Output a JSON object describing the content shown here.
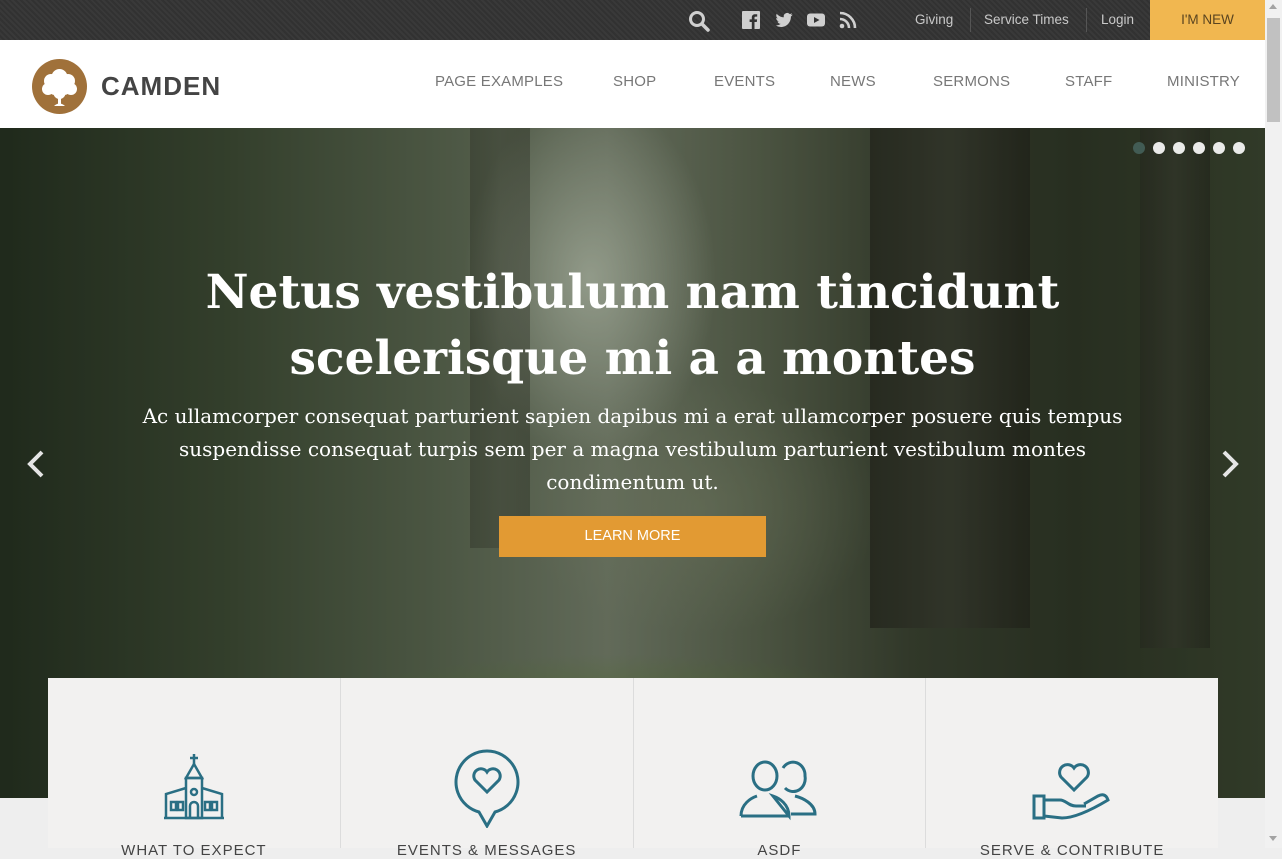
{
  "topbar": {
    "icons": [
      "search-icon",
      "facebook-icon",
      "twitter-icon",
      "youtube-icon",
      "rss-icon"
    ],
    "links": [
      "Giving",
      "Service Times",
      "Login"
    ],
    "cta": "I'M NEW",
    "cta_color": "#f1b750"
  },
  "header": {
    "logo_text": "CAMDEN",
    "logo_icon": "tree-icon",
    "brand_color": "#a0713a",
    "nav": [
      "PAGE EXAMPLES",
      "SHOP",
      "EVENTS",
      "NEWS",
      "SERMONS",
      "STAFF",
      "MINISTRY"
    ]
  },
  "hero": {
    "title": "Netus vestibulum nam tincidunt scelerisque mi a a montes",
    "description": "Ac ullamcorper consequat parturient sapien dapibus mi a erat ullamcorper posuere quis tempus suspendisse consequat turpis sem per a magna vestibulum parturient vestibulum montes condimentum ut.",
    "button": "LEARN MORE",
    "button_color": "#e29a33",
    "slide_count": 6,
    "active_slide": 1
  },
  "features": [
    {
      "label": "WHAT TO EXPECT",
      "icon": "church-icon"
    },
    {
      "label": "EVENTS & MESSAGES",
      "icon": "heart-bubble-icon"
    },
    {
      "label": "ASDF",
      "icon": "people-icon"
    },
    {
      "label": "SERVE & CONTRIBUTE",
      "icon": "hand-heart-icon"
    }
  ],
  "accent_teal": "#2a6f84"
}
